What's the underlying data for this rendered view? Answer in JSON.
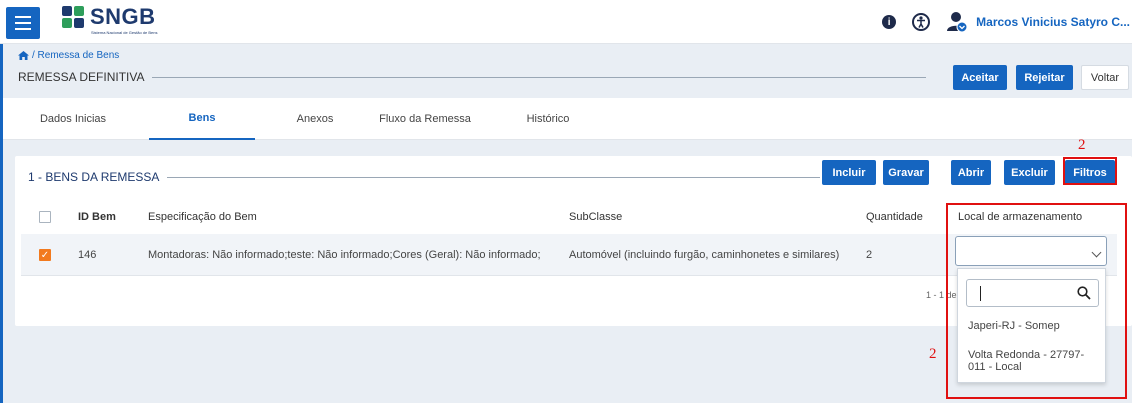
{
  "app": {
    "name": "SNGB",
    "subtitle": "Sistema Nacional de Gestão de Bens",
    "user_name": "Marcos Vinicius Satyro C..."
  },
  "header": {
    "breadcrumb": "/ Remessa de Bens",
    "page_title": "REMESSA DEFINITIVA",
    "buttons": {
      "aceitar": "Aceitar",
      "rejeitar": "Rejeitar",
      "voltar": "Voltar"
    }
  },
  "tabs": [
    {
      "label": "Dados Inicias"
    },
    {
      "label": "Bens",
      "active": true
    },
    {
      "label": "Anexos"
    },
    {
      "label": "Fluxo da Remessa"
    },
    {
      "label": "Histórico"
    }
  ],
  "section": {
    "title": "1 - BENS DA REMESSA",
    "buttons": {
      "incluir": "Incluir",
      "gravar": "Gravar",
      "abrir": "Abrir",
      "excluir": "Excluir",
      "filtros": "Filtros"
    }
  },
  "table": {
    "columns": [
      "ID Bem",
      "Especificação do Bem",
      "SubClasse",
      "Quantidade",
      "Local de armazenamento"
    ],
    "rows": [
      {
        "checked": true,
        "id": "146",
        "spec": "Montadoras: Não informado;teste: Não informado;Cores (Geral): Não informado;",
        "subclass": "Automóvel (incluindo furgão, caminhonetes e similares)",
        "quantity": "2",
        "location": ""
      }
    ],
    "pager_text": "1 - 1 de"
  },
  "dropdown": {
    "search_value": "",
    "options": [
      "Japeri-RJ - Somep",
      "Volta Redonda - 27797-011 - Local"
    ]
  },
  "annotations": {
    "label_1": "2",
    "label_2": "2"
  },
  "colors": {
    "primary": "#1565c0",
    "checkbox_checked": "#f27a1e",
    "annotation": "#e01010",
    "logo_navy": "#1e3a6e"
  }
}
